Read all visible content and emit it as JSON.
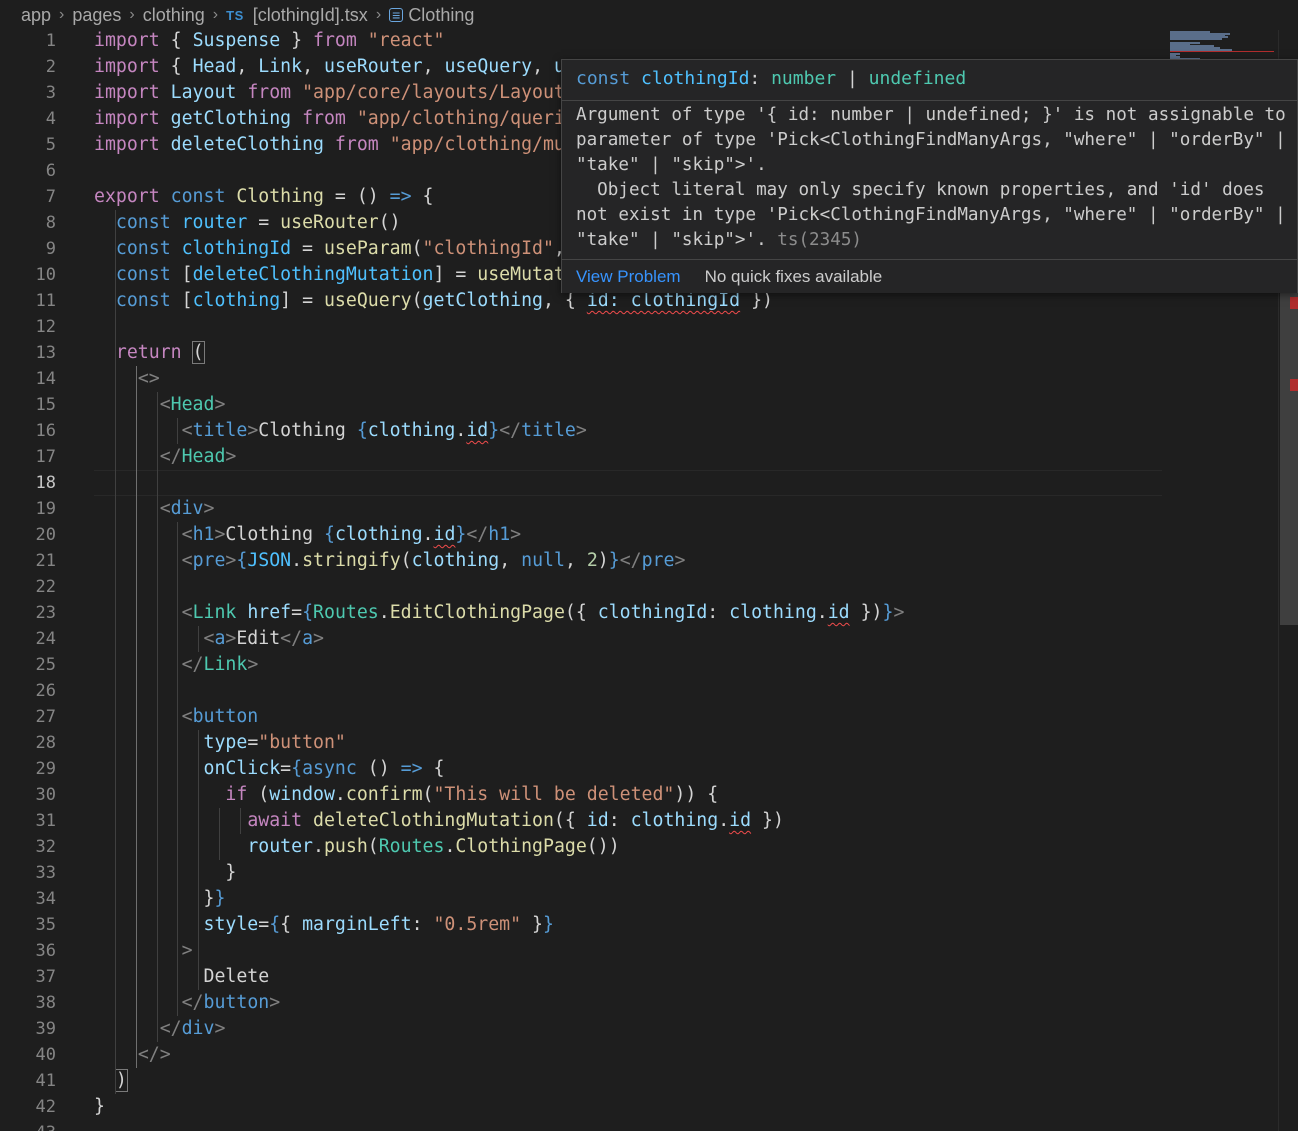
{
  "breadcrumb": {
    "items": [
      "app",
      "pages",
      "clothing"
    ],
    "file_badge": "TS",
    "file_name": "[clothingId].tsx",
    "symbol_icon": "symbol-variable-icon",
    "symbol": "Clothing"
  },
  "editor": {
    "active_line": 18,
    "lines": [
      {
        "n": 1,
        "tokens": [
          [
            "import",
            "k"
          ],
          [
            " { ",
            "p"
          ],
          [
            "Suspense",
            "v"
          ],
          [
            " } ",
            "p"
          ],
          [
            "from",
            "k"
          ],
          [
            " ",
            "p"
          ],
          [
            "\"react\"",
            "s"
          ]
        ]
      },
      {
        "n": 2,
        "tokens": [
          [
            "import",
            "k"
          ],
          [
            " { ",
            "p"
          ],
          [
            "Head",
            "v"
          ],
          [
            ", ",
            "p"
          ],
          [
            "Link",
            "v"
          ],
          [
            ", ",
            "p"
          ],
          [
            "useRouter",
            "v"
          ],
          [
            ", ",
            "p"
          ],
          [
            "useQuery",
            "v"
          ],
          [
            ", ",
            "p"
          ],
          [
            "use",
            "v"
          ]
        ]
      },
      {
        "n": 3,
        "tokens": [
          [
            "import",
            "k"
          ],
          [
            " ",
            "p"
          ],
          [
            "Layout",
            "v"
          ],
          [
            " ",
            "p"
          ],
          [
            "from",
            "k"
          ],
          [
            " ",
            "p"
          ],
          [
            "\"app/core/layouts/Layout\"",
            "s"
          ]
        ]
      },
      {
        "n": 4,
        "tokens": [
          [
            "import",
            "k"
          ],
          [
            " ",
            "p"
          ],
          [
            "getClothing",
            "v"
          ],
          [
            " ",
            "p"
          ],
          [
            "from",
            "k"
          ],
          [
            " ",
            "p"
          ],
          [
            "\"app/clothing/queries",
            "s"
          ]
        ]
      },
      {
        "n": 5,
        "tokens": [
          [
            "import",
            "k"
          ],
          [
            " ",
            "p"
          ],
          [
            "deleteClothing",
            "v"
          ],
          [
            " ",
            "p"
          ],
          [
            "from",
            "k"
          ],
          [
            " ",
            "p"
          ],
          [
            "\"app/clothing/muta",
            "s"
          ]
        ]
      },
      {
        "n": 6,
        "tokens": []
      },
      {
        "n": 7,
        "tokens": [
          [
            "export",
            "k"
          ],
          [
            " ",
            "p"
          ],
          [
            "const",
            "b"
          ],
          [
            " ",
            "p"
          ],
          [
            "Clothing",
            "f"
          ],
          [
            " = () ",
            "p"
          ],
          [
            "=>",
            "b"
          ],
          [
            " {",
            "p"
          ]
        ]
      },
      {
        "n": 8,
        "tokens": [
          [
            "  ",
            "p"
          ],
          [
            "const",
            "b"
          ],
          [
            " ",
            "p"
          ],
          [
            "router",
            "c"
          ],
          [
            " = ",
            "p"
          ],
          [
            "useRouter",
            "f"
          ],
          [
            "()",
            "p"
          ]
        ]
      },
      {
        "n": 9,
        "tokens": [
          [
            "  ",
            "p"
          ],
          [
            "const",
            "b"
          ],
          [
            " ",
            "p"
          ],
          [
            "clothingId",
            "c"
          ],
          [
            " = ",
            "p"
          ],
          [
            "useParam",
            "f"
          ],
          [
            "(",
            "p"
          ],
          [
            "\"clothingId\"",
            "s"
          ],
          [
            ", ",
            "p"
          ],
          [
            "\"",
            "s"
          ]
        ]
      },
      {
        "n": 10,
        "tokens": [
          [
            "  ",
            "p"
          ],
          [
            "const",
            "b"
          ],
          [
            " [",
            "p"
          ],
          [
            "deleteClothingMutation",
            "c"
          ],
          [
            "] = ",
            "p"
          ],
          [
            "useMutatio",
            "f"
          ]
        ]
      },
      {
        "n": 11,
        "tokens": [
          [
            "  ",
            "p"
          ],
          [
            "const",
            "b"
          ],
          [
            " [",
            "p"
          ],
          [
            "clothing",
            "c"
          ],
          [
            "] = ",
            "p"
          ],
          [
            "useQuery",
            "f"
          ],
          [
            "(",
            "p"
          ],
          [
            "getClothing",
            "v"
          ],
          [
            ", { ",
            "p"
          ],
          [
            "id: clothingId",
            "vsq"
          ],
          [
            " })",
            "p"
          ]
        ]
      },
      {
        "n": 12,
        "tokens": []
      },
      {
        "n": 13,
        "tokens": [
          [
            "  ",
            "p"
          ],
          [
            "return",
            "k"
          ],
          [
            " ",
            "p"
          ],
          [
            "(",
            "pbr"
          ]
        ]
      },
      {
        "n": 14,
        "tokens": [
          [
            "    ",
            "p"
          ],
          [
            "<>",
            "g"
          ]
        ]
      },
      {
        "n": 15,
        "tokens": [
          [
            "      ",
            "p"
          ],
          [
            "<",
            "g"
          ],
          [
            "Head",
            "t"
          ],
          [
            ">",
            "g"
          ]
        ]
      },
      {
        "n": 16,
        "tokens": [
          [
            "        ",
            "p"
          ],
          [
            "<",
            "g"
          ],
          [
            "title",
            "b"
          ],
          [
            ">",
            "g"
          ],
          [
            "Clothing ",
            "p"
          ],
          [
            "{",
            "b"
          ],
          [
            "clothing",
            "v"
          ],
          [
            ".",
            "p"
          ],
          [
            "id",
            "vsq"
          ],
          [
            "}",
            "b"
          ],
          [
            "</",
            "g"
          ],
          [
            "title",
            "b"
          ],
          [
            ">",
            "g"
          ]
        ]
      },
      {
        "n": 17,
        "tokens": [
          [
            "      ",
            "p"
          ],
          [
            "</",
            "g"
          ],
          [
            "Head",
            "t"
          ],
          [
            ">",
            "g"
          ]
        ]
      },
      {
        "n": 18,
        "tokens": []
      },
      {
        "n": 19,
        "tokens": [
          [
            "      ",
            "p"
          ],
          [
            "<",
            "g"
          ],
          [
            "div",
            "b"
          ],
          [
            ">",
            "g"
          ]
        ]
      },
      {
        "n": 20,
        "tokens": [
          [
            "        ",
            "p"
          ],
          [
            "<",
            "g"
          ],
          [
            "h1",
            "b"
          ],
          [
            ">",
            "g"
          ],
          [
            "Clothing ",
            "p"
          ],
          [
            "{",
            "b"
          ],
          [
            "clothing",
            "v"
          ],
          [
            ".",
            "p"
          ],
          [
            "id",
            "vsq"
          ],
          [
            "}",
            "b"
          ],
          [
            "</",
            "g"
          ],
          [
            "h1",
            "b"
          ],
          [
            ">",
            "g"
          ]
        ]
      },
      {
        "n": 21,
        "tokens": [
          [
            "        ",
            "p"
          ],
          [
            "<",
            "g"
          ],
          [
            "pre",
            "b"
          ],
          [
            ">",
            "g"
          ],
          [
            "{",
            "b"
          ],
          [
            "JSON",
            "c"
          ],
          [
            ".",
            "p"
          ],
          [
            "stringify",
            "f"
          ],
          [
            "(",
            "p"
          ],
          [
            "clothing",
            "v"
          ],
          [
            ", ",
            "p"
          ],
          [
            "null",
            "b"
          ],
          [
            ", ",
            "p"
          ],
          [
            "2",
            "n"
          ],
          [
            ")",
            "p"
          ],
          [
            "}",
            "b"
          ],
          [
            "</",
            "g"
          ],
          [
            "pre",
            "b"
          ],
          [
            ">",
            "g"
          ]
        ]
      },
      {
        "n": 22,
        "tokens": []
      },
      {
        "n": 23,
        "tokens": [
          [
            "        ",
            "p"
          ],
          [
            "<",
            "g"
          ],
          [
            "Link",
            "t"
          ],
          [
            " ",
            "p"
          ],
          [
            "href",
            "v"
          ],
          [
            "=",
            "p"
          ],
          [
            "{",
            "b"
          ],
          [
            "Routes",
            "t"
          ],
          [
            ".",
            "p"
          ],
          [
            "EditClothingPage",
            "f"
          ],
          [
            "({ ",
            "p"
          ],
          [
            "clothingId",
            "v"
          ],
          [
            ": ",
            "p"
          ],
          [
            "clothing",
            "v"
          ],
          [
            ".",
            "p"
          ],
          [
            "id",
            "vsq"
          ],
          [
            " })",
            "p"
          ],
          [
            "}",
            "b"
          ],
          [
            ">",
            "g"
          ]
        ]
      },
      {
        "n": 24,
        "tokens": [
          [
            "          ",
            "p"
          ],
          [
            "<",
            "g"
          ],
          [
            "a",
            "b"
          ],
          [
            ">",
            "g"
          ],
          [
            "Edit",
            "p"
          ],
          [
            "</",
            "g"
          ],
          [
            "a",
            "b"
          ],
          [
            ">",
            "g"
          ]
        ]
      },
      {
        "n": 25,
        "tokens": [
          [
            "        ",
            "p"
          ],
          [
            "</",
            "g"
          ],
          [
            "Link",
            "t"
          ],
          [
            ">",
            "g"
          ]
        ]
      },
      {
        "n": 26,
        "tokens": []
      },
      {
        "n": 27,
        "tokens": [
          [
            "        ",
            "p"
          ],
          [
            "<",
            "g"
          ],
          [
            "button",
            "b"
          ]
        ]
      },
      {
        "n": 28,
        "tokens": [
          [
            "          ",
            "p"
          ],
          [
            "type",
            "v"
          ],
          [
            "=",
            "p"
          ],
          [
            "\"button\"",
            "s"
          ]
        ]
      },
      {
        "n": 29,
        "tokens": [
          [
            "          ",
            "p"
          ],
          [
            "onClick",
            "v"
          ],
          [
            "=",
            "p"
          ],
          [
            "{",
            "b"
          ],
          [
            "async",
            "b"
          ],
          [
            " () ",
            "p"
          ],
          [
            "=>",
            "b"
          ],
          [
            " {",
            "p"
          ]
        ]
      },
      {
        "n": 30,
        "tokens": [
          [
            "            ",
            "p"
          ],
          [
            "if",
            "k"
          ],
          [
            " (",
            "p"
          ],
          [
            "window",
            "v"
          ],
          [
            ".",
            "p"
          ],
          [
            "confirm",
            "f"
          ],
          [
            "(",
            "p"
          ],
          [
            "\"This will be deleted\"",
            "s"
          ],
          [
            ")) {",
            "p"
          ]
        ]
      },
      {
        "n": 31,
        "tokens": [
          [
            "              ",
            "p"
          ],
          [
            "await",
            "k"
          ],
          [
            " ",
            "p"
          ],
          [
            "deleteClothingMutation",
            "f"
          ],
          [
            "({ ",
            "p"
          ],
          [
            "id",
            "v"
          ],
          [
            ": ",
            "p"
          ],
          [
            "clothing",
            "v"
          ],
          [
            ".",
            "p"
          ],
          [
            "id",
            "vsq"
          ],
          [
            " })",
            "p"
          ]
        ]
      },
      {
        "n": 32,
        "tokens": [
          [
            "              ",
            "p"
          ],
          [
            "router",
            "v"
          ],
          [
            ".",
            "p"
          ],
          [
            "push",
            "f"
          ],
          [
            "(",
            "p"
          ],
          [
            "Routes",
            "t"
          ],
          [
            ".",
            "p"
          ],
          [
            "ClothingPage",
            "f"
          ],
          [
            "())",
            "p"
          ]
        ]
      },
      {
        "n": 33,
        "tokens": [
          [
            "            ",
            "p"
          ],
          [
            "}",
            "p"
          ]
        ]
      },
      {
        "n": 34,
        "tokens": [
          [
            "          ",
            "p"
          ],
          [
            "}",
            "p"
          ],
          [
            "}",
            "b"
          ]
        ]
      },
      {
        "n": 35,
        "tokens": [
          [
            "          ",
            "p"
          ],
          [
            "style",
            "v"
          ],
          [
            "=",
            "p"
          ],
          [
            "{",
            "b"
          ],
          [
            "{ ",
            "p"
          ],
          [
            "marginLeft",
            "v"
          ],
          [
            ": ",
            "p"
          ],
          [
            "\"0.5rem\"",
            "s"
          ],
          [
            " }",
            "p"
          ],
          [
            "}",
            "b"
          ]
        ]
      },
      {
        "n": 36,
        "tokens": [
          [
            "        ",
            "p"
          ],
          [
            ">",
            "g"
          ]
        ]
      },
      {
        "n": 37,
        "tokens": [
          [
            "          ",
            "p"
          ],
          [
            "Delete",
            "p"
          ]
        ]
      },
      {
        "n": 38,
        "tokens": [
          [
            "        ",
            "p"
          ],
          [
            "</",
            "g"
          ],
          [
            "button",
            "b"
          ],
          [
            ">",
            "g"
          ]
        ]
      },
      {
        "n": 39,
        "tokens": [
          [
            "      ",
            "p"
          ],
          [
            "</",
            "g"
          ],
          [
            "div",
            "b"
          ],
          [
            ">",
            "g"
          ]
        ]
      },
      {
        "n": 40,
        "tokens": [
          [
            "    ",
            "p"
          ],
          [
            "</>",
            "g"
          ]
        ]
      },
      {
        "n": 41,
        "tokens": [
          [
            "  ",
            "p"
          ],
          [
            ")",
            "pbr"
          ]
        ]
      },
      {
        "n": 42,
        "tokens": [
          [
            "}",
            "p"
          ]
        ]
      },
      {
        "n": 43,
        "tokens": []
      }
    ]
  },
  "hover": {
    "signature": [
      [
        "const",
        "b"
      ],
      [
        " ",
        "p"
      ],
      [
        "clothingId",
        "c"
      ],
      [
        ": ",
        "p"
      ],
      [
        "number",
        "t"
      ],
      [
        " | ",
        "p"
      ],
      [
        "undefined",
        "t"
      ]
    ],
    "message": "Argument of type '{ id: number | undefined; }' is not assignable to\nparameter of type 'Pick<ClothingFindManyArgs, \"where\" | \"orderBy\" |\n\"take\" | \"skip\">'.\n  Object literal may only specify known properties, and 'id' does\nnot exist in type 'Pick<ClothingFindManyArgs, \"where\" | \"orderBy\" |\n\"take\" | \"skip\">'.",
    "code_ref": " ts(2345)",
    "view_problem": "View Problem",
    "no_fixes": "No quick fixes available"
  },
  "colors": {
    "background": "#1e1e1e",
    "keyword": "#c586c0",
    "storage": "#569cd6",
    "variable": "#9cdcfe",
    "constant": "#4fc1ff",
    "function": "#dcdcaa",
    "type": "#4ec9b0",
    "string": "#ce9178",
    "error_squiggle": "#f14c4c",
    "link": "#3794ff"
  }
}
